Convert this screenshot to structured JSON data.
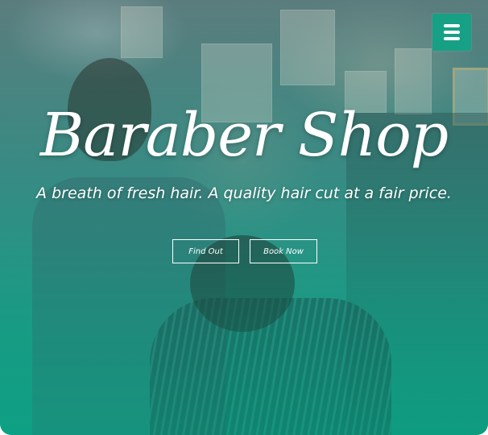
{
  "hero": {
    "title": "Baraber Shop",
    "subtitle": "A breath of fresh hair. A quality hair cut at a fair price.",
    "buttons": {
      "find_out": "Find Out",
      "book_now": "Book Now"
    }
  },
  "nav": {
    "menu_icon": "hamburger-menu-icon"
  },
  "colors": {
    "accent": "#16a085",
    "text": "#ffffff",
    "overlay_bottom": "#13a086"
  }
}
